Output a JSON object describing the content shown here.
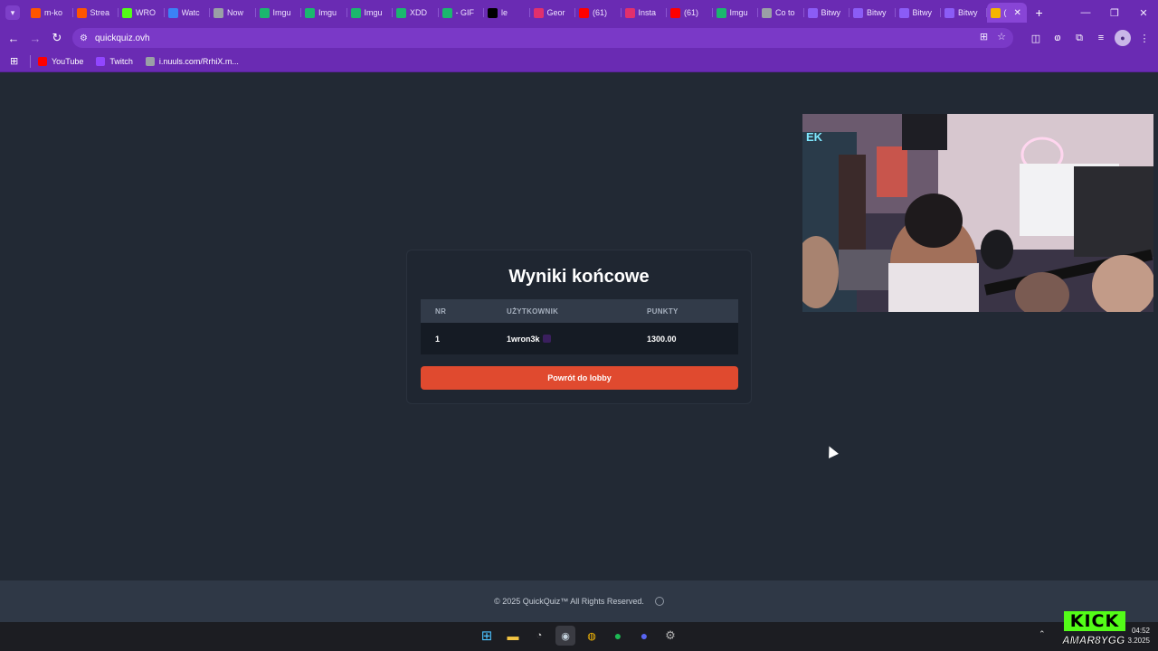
{
  "browser": {
    "tabs": [
      {
        "label": "m-ko",
        "icon": "soundcloud-icon",
        "color": "#ff5500"
      },
      {
        "label": "Strea",
        "icon": "soundcloud-icon",
        "color": "#ff5500"
      },
      {
        "label": "WRO",
        "icon": "kick-icon",
        "color": "#53fc18"
      },
      {
        "label": "Watc",
        "icon": "watch-icon",
        "color": "#3b82f6"
      },
      {
        "label": "Now",
        "icon": "globe-icon",
        "color": "#9aa0a6"
      },
      {
        "label": "Imgu",
        "icon": "imgur-icon",
        "color": "#1bb76e"
      },
      {
        "label": "Imgu",
        "icon": "imgur-icon",
        "color": "#1bb76e"
      },
      {
        "label": "Imgu",
        "icon": "imgur-icon",
        "color": "#1bb76e"
      },
      {
        "label": "XDD",
        "icon": "imgur-icon",
        "color": "#1bb76e"
      },
      {
        "label": "- GIF",
        "icon": "imgur-icon",
        "color": "#1bb76e"
      },
      {
        "label": "le",
        "icon": "tiktok-icon",
        "color": "#000000"
      },
      {
        "label": "Geor",
        "icon": "instagram-icon",
        "color": "#e1306c"
      },
      {
        "label": "(61)",
        "icon": "youtube-icon",
        "color": "#ff0000"
      },
      {
        "label": "Insta",
        "icon": "instagram-icon",
        "color": "#e1306c"
      },
      {
        "label": "(61)",
        "icon": "youtube-icon",
        "color": "#ff0000"
      },
      {
        "label": "Imgu",
        "icon": "imgur-icon",
        "color": "#1bb76e"
      },
      {
        "label": "Co to",
        "icon": "chat-icon",
        "color": "#9aa0a6"
      },
      {
        "label": "Bitwy",
        "icon": "bitwy-icon",
        "color": "#8b5cf6"
      },
      {
        "label": "Bitwy",
        "icon": "bitwy-icon",
        "color": "#8b5cf6"
      },
      {
        "label": "Bitwy",
        "icon": "bitwy-icon",
        "color": "#8b5cf6"
      },
      {
        "label": "Bitwy",
        "icon": "bitwy-icon",
        "color": "#8b5cf6"
      }
    ],
    "active_tab": {
      "label": "(",
      "icon": "quiz-icon",
      "color": "#f4b400"
    },
    "url": "quickquiz.ovh",
    "bookmarks": [
      {
        "label": "YouTube",
        "icon": "youtube-icon",
        "color": "#ff0000"
      },
      {
        "label": "Twitch",
        "icon": "twitch-icon",
        "color": "#9146ff"
      },
      {
        "label": "i.nuuls.com/RrhiX.m...",
        "icon": "globe-icon",
        "color": "#9aa0a6"
      }
    ]
  },
  "results": {
    "title": "Wyniki końcowe",
    "columns": [
      "NR",
      "UŻYTKOWNIK",
      "PUNKTY"
    ],
    "rows": [
      {
        "nr": "1",
        "user": "1wron3k",
        "points": "1300.00"
      }
    ],
    "button_label": "Powrót do lobby",
    "accent": "#e04a2f"
  },
  "footer": {
    "text": "© 2025  QuickQuiz™ All Rights Reserved.",
    "icon": "github-icon"
  },
  "overlay": {
    "kick_logo": "KICK",
    "kick_user": "AMAR8YGG",
    "clock_time": "04:52",
    "clock_date": "3.2025"
  }
}
